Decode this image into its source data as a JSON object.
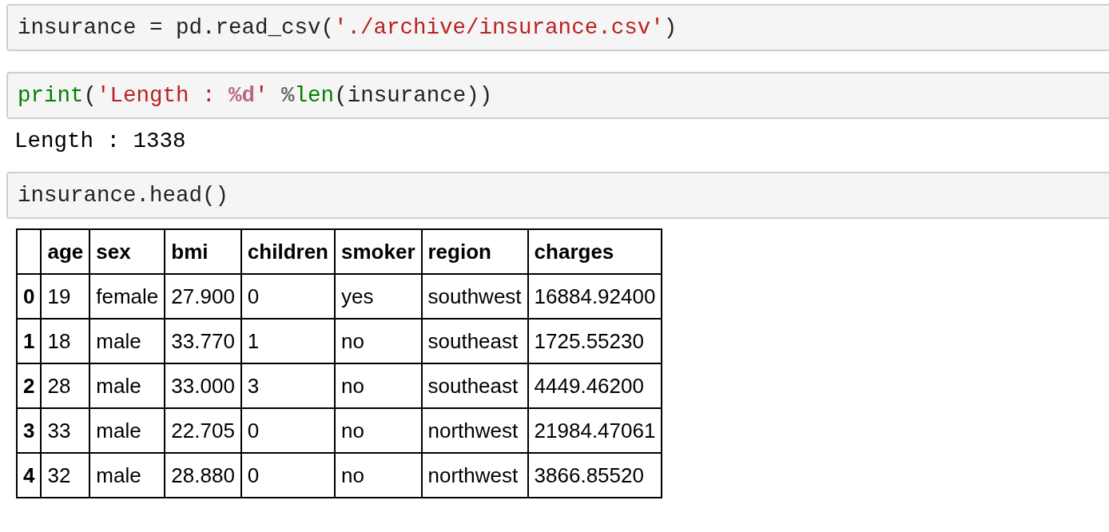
{
  "cells": [
    {
      "kind": "code",
      "tokens": [
        {
          "kind": "plain",
          "text": "insurance = pd.read_csv("
        },
        {
          "kind": "string",
          "text": "'./archive/insurance.csv'"
        },
        {
          "kind": "plain",
          "text": ")"
        }
      ]
    },
    {
      "kind": "code",
      "tokens": [
        {
          "kind": "builtin",
          "text": "print"
        },
        {
          "kind": "plain",
          "text": "("
        },
        {
          "kind": "string",
          "text": "'Length : "
        },
        {
          "kind": "format",
          "text": "%d"
        },
        {
          "kind": "string",
          "text": "' "
        },
        {
          "kind": "operator",
          "text": "%"
        },
        {
          "kind": "builtin",
          "text": "len"
        },
        {
          "kind": "plain",
          "text": "(insurance))"
        }
      ]
    },
    {
      "kind": "output",
      "text": "Length : 1338"
    },
    {
      "kind": "code",
      "tokens": [
        {
          "kind": "plain",
          "text": "insurance.head()"
        }
      ]
    },
    {
      "kind": "table",
      "columns": [
        "age",
        "sex",
        "bmi",
        "children",
        "smoker",
        "region",
        "charges"
      ],
      "rows": [
        {
          "index": "0",
          "cells": [
            "19",
            "female",
            "27.900",
            "0",
            "yes",
            "southwest",
            "16884.92400"
          ]
        },
        {
          "index": "1",
          "cells": [
            "18",
            "male",
            "33.770",
            "1",
            "no",
            "southeast",
            "1725.55230"
          ]
        },
        {
          "index": "2",
          "cells": [
            "28",
            "male",
            "33.000",
            "3",
            "no",
            "southeast",
            "4449.46200"
          ]
        },
        {
          "index": "3",
          "cells": [
            "33",
            "male",
            "22.705",
            "0",
            "no",
            "northwest",
            "21984.47061"
          ]
        },
        {
          "index": "4",
          "cells": [
            "32",
            "male",
            "28.880",
            "0",
            "no",
            "northwest",
            "3866.85520"
          ]
        }
      ]
    }
  ]
}
